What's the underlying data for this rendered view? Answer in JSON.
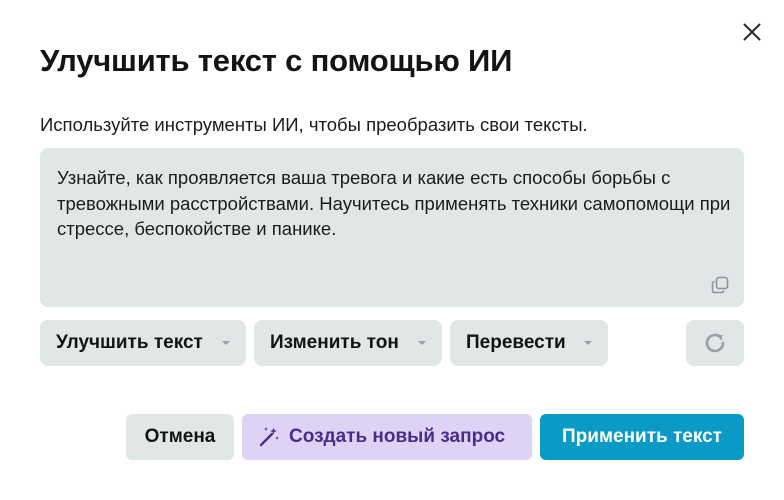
{
  "dialog": {
    "title": "Улучшить текст с помощью ИИ",
    "description": "Используйте инструменты ИИ, чтобы преобразить свои тексты.",
    "close_icon": "close-icon"
  },
  "editor": {
    "text": "Узнайте, как проявляется ваша тревога и какие есть способы борьбы с тревожными расстройствами. Научитесь применять техники самопомощи при стрессе, беспокойстве и панике.",
    "copy_icon": "copy-icon"
  },
  "toolbar": {
    "improve_label": "Улучшить текст",
    "tone_label": "Изменить тон",
    "translate_label": "Перевести",
    "dropdown_icon": "chevron-down-icon",
    "regenerate_icon": "refresh-icon"
  },
  "footer": {
    "cancel_label": "Отмена",
    "new_request_label": "Создать новый запрос",
    "new_request_icon": "magic-wand-icon",
    "apply_label": "Применить текст"
  },
  "colors": {
    "primary": "#0a9ac6",
    "secondary_bg": "#e1e6e6",
    "ai_bg": "#dfd3f5",
    "ai_text": "#4a2c8c"
  }
}
